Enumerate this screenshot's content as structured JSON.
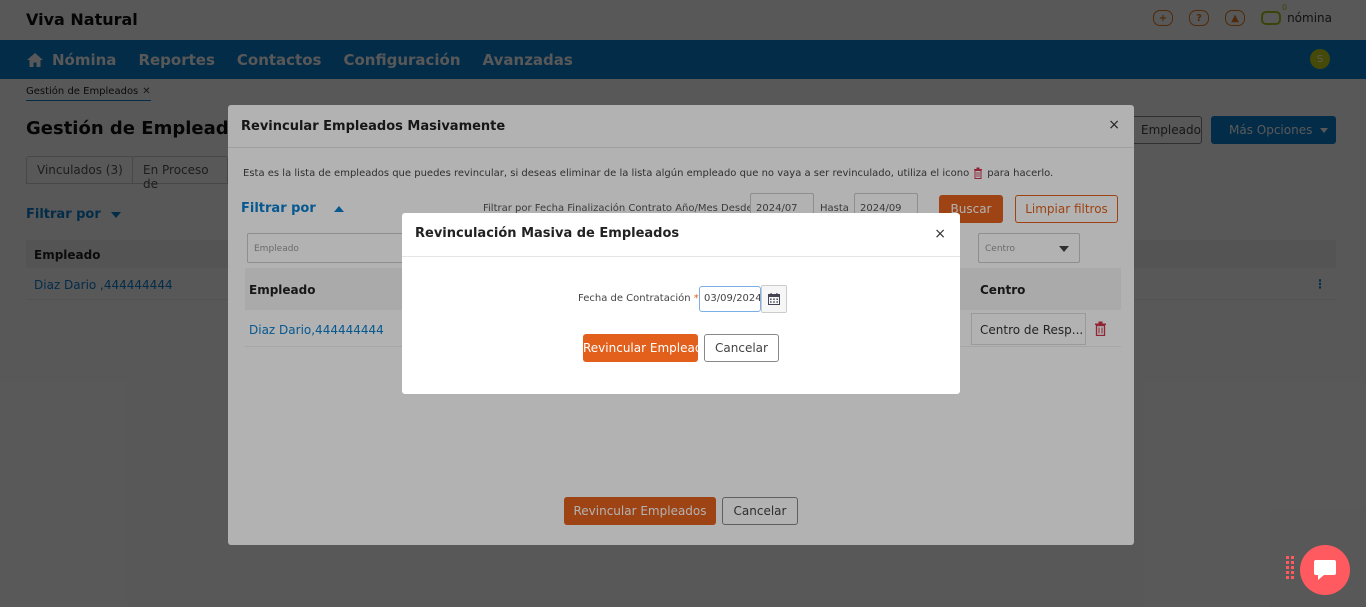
{
  "app": {
    "brand": "Viva Natural",
    "logo_text": "nómina",
    "top_icons": [
      "plus-circle-icon",
      "help-icon",
      "bell-icon"
    ],
    "top_icon_glyphs": [
      "+",
      "?",
      "▲"
    ]
  },
  "nav": {
    "items": [
      {
        "label": "Nómina",
        "icon": "home-icon"
      },
      {
        "label": "Reportes"
      },
      {
        "label": "Contactos"
      },
      {
        "label": "Configuración"
      },
      {
        "label": "Avanzadas"
      }
    ],
    "badge": "S"
  },
  "page": {
    "breadcrumb": "Gestión de Empleados",
    "breadcrumb_close": "✕",
    "title": "Gestión de Empleados",
    "tabs": [
      "Vinculados (3)",
      "En Proceso de"
    ],
    "filter_label": "Filtrar por",
    "table_header": "Empleado",
    "row_employee": "Diaz Dario ,444444444",
    "btn_outline": "Empleado",
    "btn_more": "Más Opciones"
  },
  "modal_big": {
    "title": "Revincular Empleados Masivamente",
    "close": "×",
    "description_before": "Esta es la lista de empleados que puedes revincular, si deseas eliminar de la lista algún empleado que no vaya a ser revinculado, utiliza el icono",
    "description_after": "para hacerlo.",
    "filter_label": "Filtrar por",
    "date_filter_label": "Filtrar por Fecha Finalización Contrato Año/Mes Desde",
    "date_from": "2024/07",
    "hasta_label": "Hasta",
    "date_to": "2024/09",
    "buscar": "Buscar",
    "limpiar": "Limpiar filtros",
    "filter_empleado_placeholder": "Empleado",
    "filter_centro_placeholder": "Centro",
    "col_empleado": "Empleado",
    "col_centro": "Centro",
    "row": {
      "employee": "Diaz Dario,444444444",
      "centro": "Centro de Resp..."
    },
    "btn_primary": "Revincular Empleados",
    "btn_cancel": "Cancelar"
  },
  "modal_small": {
    "title": "Revinculación Masiva de Empleados",
    "close": "×",
    "field_label": "Fecha de Contratación",
    "required_mark": "*",
    "field_value": "03/09/2024",
    "btn_primary": "Revincular Empleado",
    "btn_cancel": "Cancelar"
  },
  "colors": {
    "nav_blue": "#0a7ecf",
    "accent_orange": "#e3601c",
    "chat_red": "#ff5a5f"
  }
}
